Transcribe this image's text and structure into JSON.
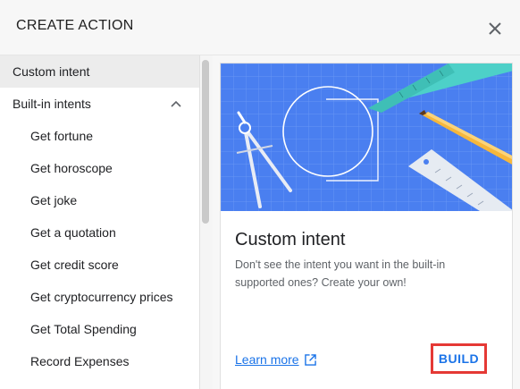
{
  "header": {
    "title": "CREATE ACTION",
    "close_icon": "close-icon"
  },
  "sidebar": {
    "items": [
      {
        "label": "Custom intent",
        "selected": true
      },
      {
        "label": "Built-in intents",
        "expanded": true,
        "icon": "chevron-up-icon"
      },
      {
        "label": "Get fortune"
      },
      {
        "label": "Get horoscope"
      },
      {
        "label": "Get joke"
      },
      {
        "label": "Get a quotation"
      },
      {
        "label": "Get credit score"
      },
      {
        "label": "Get cryptocurrency prices"
      },
      {
        "label": "Get Total Spending"
      },
      {
        "label": "Record Expenses"
      }
    ]
  },
  "card": {
    "title": "Custom intent",
    "description": "Don't see the intent you want in the built-in supported ones? Create your own!",
    "learn_more": "Learn more",
    "learn_more_icon": "open-in-new-icon",
    "build_label": "BUILD",
    "hero_image": "blueprint-drawing-tools-illustration"
  },
  "colors": {
    "accent": "#1a73e8",
    "highlight_border": "#e53935",
    "hero_blue": "#4a7ff0",
    "teal": "#4dd0c8",
    "pencil": "#f6b73c"
  }
}
